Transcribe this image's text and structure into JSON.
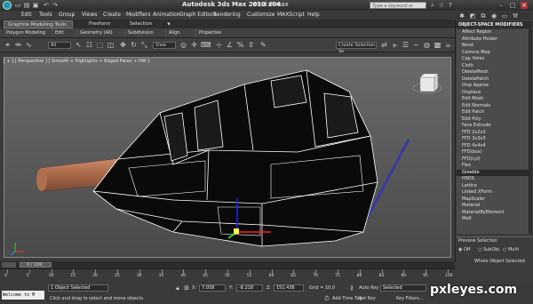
{
  "window": {
    "title": "Autodesk 3ds Max  2010 x64",
    "file": "wind 2.max",
    "search_placeholder": "Type a keyword or phrase"
  },
  "menu": [
    "Edit",
    "Tools",
    "Group",
    "Views",
    "Create",
    "Modifiers",
    "Animation",
    "Graph Editors",
    "Rendering",
    "Customize",
    "MAXScript",
    "Help"
  ],
  "ribbon": {
    "tabs": [
      "Graphite Modeling Tools",
      "Freeform",
      "Selection"
    ],
    "subtabs": [
      "Polygon Modeling",
      "Edit",
      "Geometry (All)",
      "Subdivision",
      "Align",
      "Properties"
    ]
  },
  "toolbar": {
    "filter_dropdown": "All",
    "view_dropdown": "View",
    "selection_set_placeholder": "Create Selection Se"
  },
  "viewport": {
    "label": "[ + ] [ Perspective ] [ Smooth + Highlights + Edged Faces + HW ]"
  },
  "command_panel": {
    "header": "OBJECT-SPACE MODIFIERS",
    "modifiers": [
      "Affect Region",
      "Attribute Holder",
      "Bend",
      "Camera Map",
      "Cap Holes",
      "Cloth",
      "DeleteMesh",
      "DeletePatch",
      "Disp Approx",
      "Displace",
      "Edit Mesh",
      "Edit Normals",
      "Edit Patch",
      "Edit Poly",
      "Face Extrude",
      "FFD 2x2x2",
      "FFD 3x3x3",
      "FFD 4x4x4",
      "FFD(box)",
      "FFD(cyl)",
      "Flex",
      "Greeble",
      "HSDS",
      "Lattice",
      "Linked XForm",
      "MapScaler",
      "Material",
      "MaterialByElement",
      "Melt"
    ],
    "selected_modifier": "Greeble",
    "preview_title": "Preview Selection",
    "preview_options": [
      "Off",
      "SubObj",
      "Multi"
    ],
    "preview_status": "Whole Object Selected"
  },
  "timeline": {
    "frame": "0 / 100",
    "ticks": [
      "0",
      "5",
      "10",
      "15",
      "20",
      "25",
      "30",
      "35",
      "40",
      "45",
      "50",
      "55",
      "60",
      "65",
      "70",
      "75",
      "80",
      "85",
      "90",
      "95",
      "100"
    ]
  },
  "status": {
    "maxscript_text": "Welcome to M",
    "objects_selected": "1 Object Selected",
    "prompt": "Click and drag to select and move objects",
    "x_label": "X:",
    "x_value": "7.058",
    "y_label": "Y:",
    "y_value": "-8.218",
    "z_label": "Z:",
    "z_value": "151.436",
    "grid": "Grid = 10.0",
    "add_time_tag": "Add Time Tag",
    "auto_key": "Auto Key",
    "set_key": "Set Key",
    "key_mode": "Selected",
    "key_filters": "Key Filters..."
  },
  "watermark": "pxleyes.com",
  "colors": {
    "selection_highlight": "#2a2a2a",
    "viewport_bg": "#5a5a5a",
    "wire_color": "#ffffff"
  }
}
